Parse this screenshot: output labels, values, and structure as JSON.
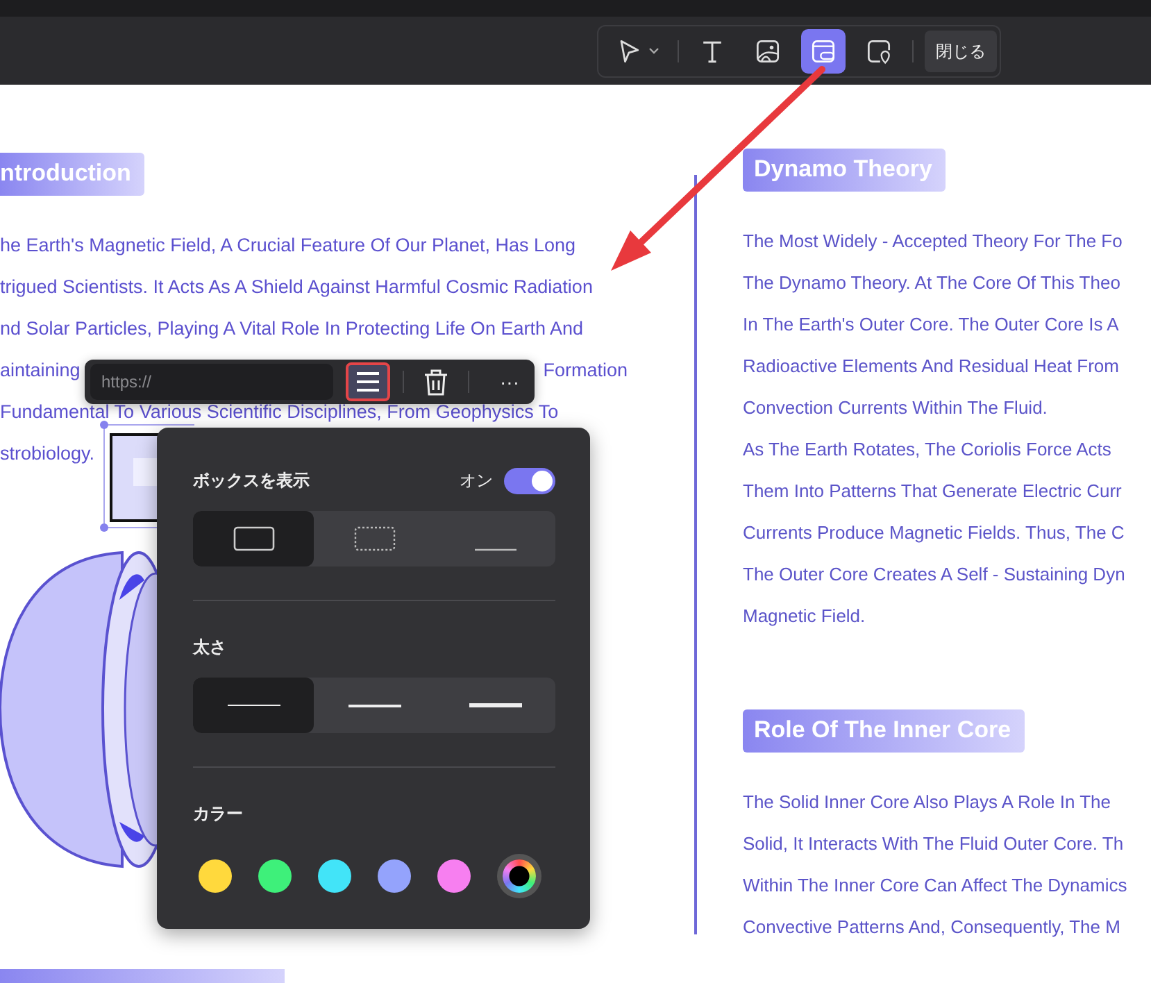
{
  "toolbar": {
    "tools": [
      {
        "kind": "select",
        "selected": false
      },
      {
        "kind": "text",
        "selected": false
      },
      {
        "kind": "image",
        "selected": false
      },
      {
        "kind": "link",
        "selected": true
      },
      {
        "kind": "location",
        "selected": false
      }
    ],
    "close_button": "閉じる"
  },
  "document": {
    "left_column": {
      "heading": "ntroduction",
      "lines": [
        [
          "he Earth's Magnetic Field, A Crucial Feature Of Our Planet, Has Long"
        ],
        [
          "trigued Scientists. It Acts As A Shield Against Harmful Cosmic Radiation"
        ],
        [
          "nd Solar Particles, Playing A Vital Role In Protecting Life On Earth And"
        ],
        [
          "aintaining",
          "Formation"
        ],
        [
          "Fundamental To Various Scientific Disciplines, From Geophysics To"
        ],
        [
          "strobiology."
        ]
      ]
    },
    "right_column": {
      "sections": [
        {
          "heading": "Dynamo Theory",
          "lines": [
            "The Most Widely - Accepted Theory For The Fo",
            "The Dynamo Theory. At The Core Of This Theo",
            "In The Earth's Outer Core. The Outer Core Is A",
            "Radioactive Elements And Residual Heat From",
            "Convection Currents Within The Fluid.",
            "As The Earth Rotates, The Coriolis Force Acts",
            "Them Into Patterns That Generate Electric Curr",
            "Currents Produce Magnetic Fields. Thus, The C",
            "The Outer Core Creates A Self - Sustaining Dyn",
            "Magnetic Field."
          ]
        },
        {
          "heading": "Role Of The Inner Core",
          "lines": [
            "The Solid Inner Core Also Plays A Role In The",
            "Solid, It Interacts With The Fluid Outer Core. Th",
            "Within The Inner Core Can Affect The Dynamics",
            "Convective Patterns And, Consequently, The M"
          ]
        }
      ]
    }
  },
  "link_popup": {
    "url_field": {
      "placeholder": "https://"
    },
    "menu_button": {
      "highlighted": true
    },
    "more_button": "···"
  },
  "style_panel": {
    "box_section": {
      "label": "ボックスを表示",
      "toggle_label": "オン",
      "on": true,
      "styles": [
        {
          "kind": "solid",
          "selected": true
        },
        {
          "kind": "dotted",
          "selected": false
        },
        {
          "kind": "underline",
          "selected": false
        }
      ]
    },
    "thickness_section": {
      "label": "太さ",
      "options": [
        {
          "kind": "thin",
          "selected": true
        },
        {
          "kind": "medium",
          "selected": false
        },
        {
          "kind": "thick",
          "selected": false
        }
      ]
    },
    "color_section": {
      "label": "カラー",
      "swatches": [
        {
          "kind": "swatch",
          "color": "#ffd93d",
          "selected": false
        },
        {
          "kind": "swatch",
          "color": "#3ef07a",
          "selected": false
        },
        {
          "kind": "swatch",
          "color": "#42e4f8",
          "selected": false
        },
        {
          "kind": "swatch",
          "color": "#94a3fc",
          "selected": false
        },
        {
          "kind": "swatch",
          "color": "#f77ff0",
          "selected": false
        },
        {
          "kind": "picker",
          "selected": true
        }
      ]
    }
  }
}
